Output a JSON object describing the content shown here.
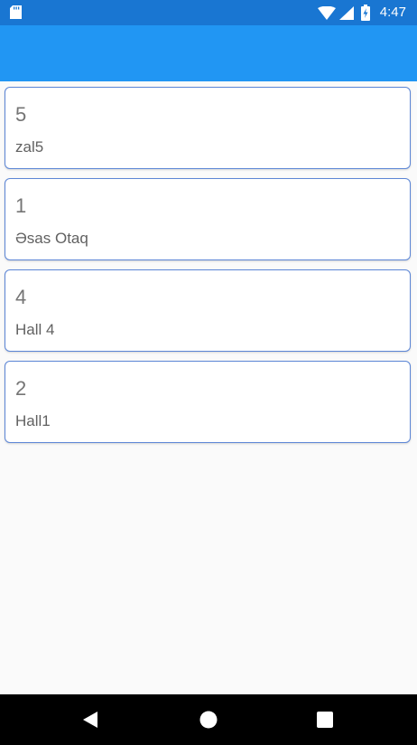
{
  "status_bar": {
    "time": "4:47",
    "icons": [
      "sd-card-icon",
      "wifi-icon",
      "cell-signal-icon",
      "battery-charging-icon"
    ]
  },
  "colors": {
    "status_bar": "#1976D2",
    "toolbar": "#2196F3",
    "card_border": "#5C86D6",
    "background": "#FAFAFA",
    "nav_bar": "#000000"
  },
  "halls": [
    {
      "number": "5",
      "name": "zal5"
    },
    {
      "number": "1",
      "name": "Əsas Otaq"
    },
    {
      "number": "4",
      "name": "Hall 4"
    },
    {
      "number": "2",
      "name": "Hall1"
    }
  ],
  "nav_bar": {
    "icons": [
      "back-icon",
      "home-icon",
      "recents-icon"
    ]
  }
}
